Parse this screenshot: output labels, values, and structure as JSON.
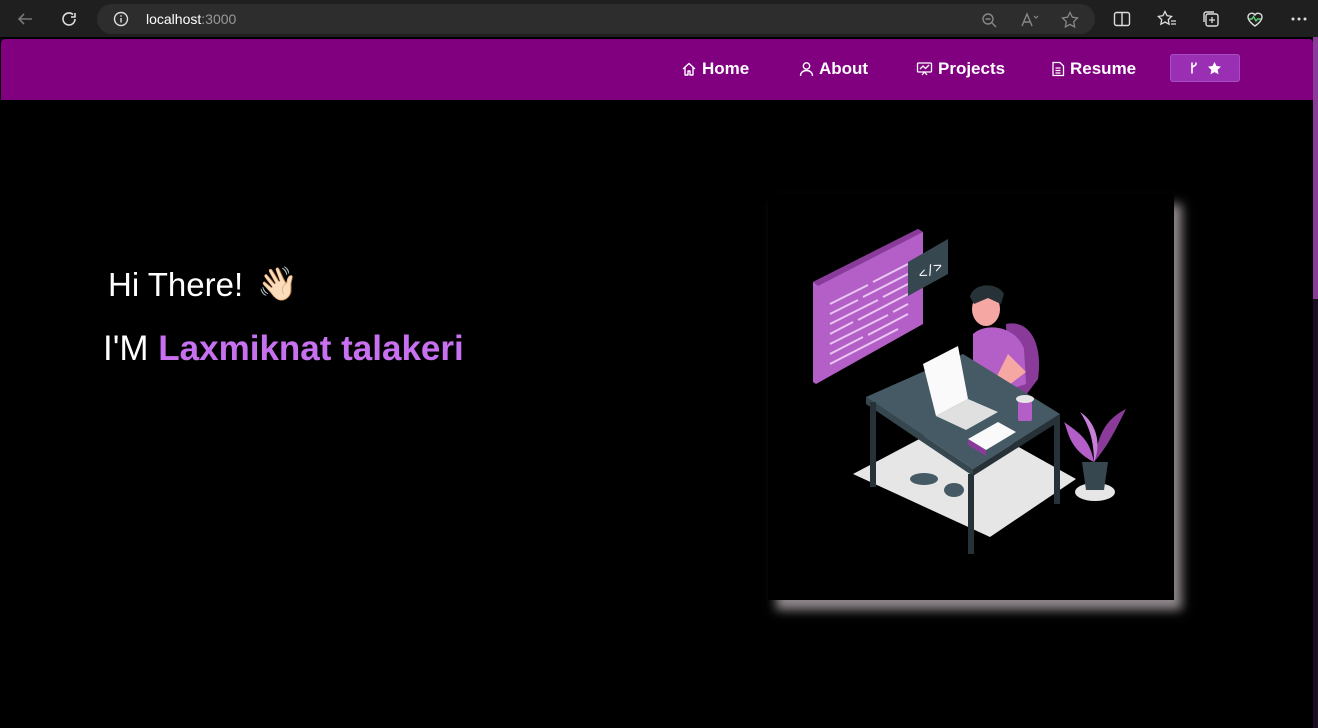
{
  "browser": {
    "url_host": "localhost",
    "url_port": ":3000"
  },
  "navbar": {
    "items": [
      {
        "label": "Home",
        "icon": "home-icon"
      },
      {
        "label": "About",
        "icon": "user-icon"
      },
      {
        "label": "Projects",
        "icon": "projects-icon"
      },
      {
        "label": "Resume",
        "icon": "document-icon"
      }
    ],
    "fork_icons": [
      "git-fork-icon",
      "star-icon"
    ]
  },
  "hero": {
    "greeting": "Hi There!",
    "wave_emoji": "👋🏻",
    "name_prefix": "I'M ",
    "name": "Laxmiknat talakeri"
  },
  "colors": {
    "navbar_bg": "#800080",
    "accent": "#c770f0",
    "page_bg": "#000000"
  }
}
